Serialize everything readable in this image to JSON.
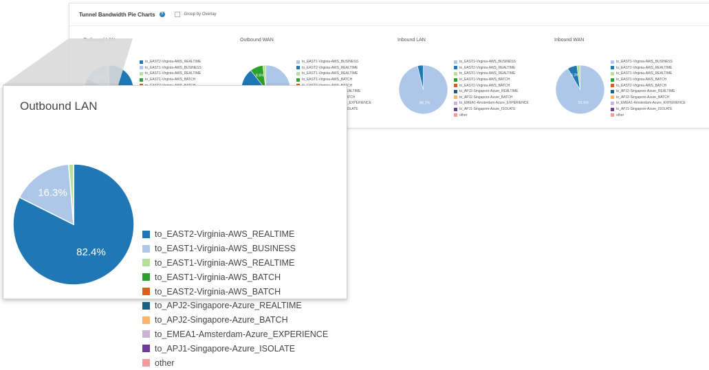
{
  "header": {
    "title": "Tunnel Bandwidth Pie Charts",
    "group_label": "Group by Overlay"
  },
  "chart_data": [
    {
      "type": "pie",
      "title": "Outbound LAN",
      "slices": [
        {
          "label": "to_EAST2-Virginia-AWS_REALTIME",
          "value": 82.4,
          "color": "#1f77b4",
          "show_label": true
        },
        {
          "label": "to_EAST1-Virginia-AWS_BUSINESS",
          "value": 16.3,
          "color": "#aec7e8",
          "show_label": true
        },
        {
          "label": "to_EAST1-Virginia-AWS_REALTIME",
          "value": 1.3,
          "color": "#b5df9a"
        }
      ],
      "legend": [
        {
          "label": "to_EAST2-Virginia-AWS_REALTIME",
          "color": "#1f77b4"
        },
        {
          "label": "to_EAST1-Virginia-AWS_BUSINESS",
          "color": "#aec7e8"
        },
        {
          "label": "to_EAST1-Virginia-AWS_REALTIME",
          "color": "#b5df9a"
        },
        {
          "label": "to_EAST1-Virginia-AWS_BATCH",
          "color": "#2ca02c"
        },
        {
          "label": "to_EAST2-Virginia-AWS_BATCH",
          "color": "#d95f1c"
        },
        {
          "label": "to_APJ2-Singapore-Azure_REALTIME",
          "color": "#1b5e7e"
        },
        {
          "label": "to_APJ2-Singapore-Azure_BATCH",
          "color": "#f7b66a"
        },
        {
          "label": "to_EMEA1-Amsterdam-Azure_EXPERIENCE",
          "color": "#c9b3d6"
        },
        {
          "label": "to_APJ1-Singapore-Azure_ISOLATE",
          "color": "#6a3d9a"
        },
        {
          "label": "other",
          "color": "#f49a9a"
        }
      ]
    },
    {
      "type": "pie",
      "title": "Outbound WAN",
      "slices": [
        {
          "label": "to_EAST1-Virginia-AWS_BUSINESS",
          "value": 75.3,
          "color": "#aec7e8"
        },
        {
          "label": "to_EAST2-Virginia-AWS_REALTIME",
          "value": 14.1,
          "color": "#1f77b4"
        },
        {
          "label": "to_EAST1-Virginia-AWS_BATCH",
          "value": 8.6,
          "color": "#2ca02c",
          "show_label": true
        },
        {
          "label": "to_EAST1-Virginia-AWS_REALTIME",
          "value": 2.0,
          "color": "#b5df9a"
        }
      ],
      "legend": [
        {
          "label": "to_EAST1-Virginia-AWS_BUSINESS",
          "color": "#aec7e8"
        },
        {
          "label": "to_EAST2-Virginia-AWS_REALTIME",
          "color": "#1f77b4"
        },
        {
          "label": "to_EAST1-Virginia-AWS_REALTIME",
          "color": "#b5df9a"
        },
        {
          "label": "to_EAST1-Virginia-AWS_BATCH",
          "color": "#2ca02c"
        },
        {
          "label": "to_EAST2-Virginia-AWS_BATCH",
          "color": "#d95f1c"
        },
        {
          "label": "to_APJ2-Singapore-Azure_REALTIME",
          "color": "#1b5e7e"
        },
        {
          "label": "to_APJ2-Singapore-Azure_BATCH",
          "color": "#f7b66a"
        },
        {
          "label": "to_EMEA1-Amsterdam-Azure_EXPERIENCE",
          "color": "#c9b3d6"
        },
        {
          "label": "to_APJ1-Singapore-Azure_ISOLATE",
          "color": "#6a3d9a"
        },
        {
          "label": "other",
          "color": "#f49a9a"
        }
      ]
    },
    {
      "type": "pie",
      "title": "Inbound LAN",
      "slices": [
        {
          "label": "to_EAST1-Virginia-AWS_BUSINESS",
          "value": 96.2,
          "color": "#aec7e8",
          "show_label": true
        },
        {
          "label": "to_EAST2-Virginia-AWS_REALTIME",
          "value": 3.8,
          "color": "#1f77b4"
        }
      ],
      "legend": [
        {
          "label": "to_EAST1-Virginia-AWS_BUSINESS",
          "color": "#aec7e8"
        },
        {
          "label": "to_EAST2-Virginia-AWS_REALTIME",
          "color": "#1f77b4"
        },
        {
          "label": "to_EAST1-Virginia-AWS_REALTIME",
          "color": "#b5df9a"
        },
        {
          "label": "to_EAST1-Virginia-AWS_BATCH",
          "color": "#2ca02c"
        },
        {
          "label": "to_EAST2-Virginia-AWS_BATCH",
          "color": "#d95f1c"
        },
        {
          "label": "to_APJ2-Singapore-Azure_REALTIME",
          "color": "#1b5e7e"
        },
        {
          "label": "to_APJ2-Singapore-Azure_BATCH",
          "color": "#f7b66a"
        },
        {
          "label": "to_EMEA1-Amsterdam-Azure_EXPERIENCE",
          "color": "#c9b3d6"
        },
        {
          "label": "to_APJ1-Singapore-Azure_ISOLATE",
          "color": "#6a3d9a"
        },
        {
          "label": "other",
          "color": "#f49a9a"
        }
      ]
    },
    {
      "type": "pie",
      "title": "Inbound WAN",
      "slices": [
        {
          "label": "to_EAST1-Virginia-AWS_BUSINESS",
          "value": 91.6,
          "color": "#aec7e8",
          "show_label": true
        },
        {
          "label": "to_EAST2-Virginia-AWS_REALTIME",
          "value": 6.3,
          "color": "#1f77b4",
          "show_label": true
        },
        {
          "label": "to_EAST1-Virginia-AWS_REALTIME",
          "value": 2.1,
          "color": "#b5df9a"
        }
      ],
      "legend": [
        {
          "label": "to_EAST1-Virginia-AWS_BUSINESS",
          "color": "#aec7e8"
        },
        {
          "label": "to_EAST2-Virginia-AWS_REALTIME",
          "color": "#1f77b4"
        },
        {
          "label": "to_EAST1-Virginia-AWS_REALTIME",
          "color": "#b5df9a"
        },
        {
          "label": "to_EAST1-Virginia-AWS_BATCH",
          "color": "#2ca02c"
        },
        {
          "label": "to_EAST2-Virginia-AWS_BATCH",
          "color": "#d95f1c"
        },
        {
          "label": "to_APJ2-Singapore-Azure_REALTIME",
          "color": "#1b5e7e"
        },
        {
          "label": "to_APJ2-Singapore-Azure_BATCH",
          "color": "#f7b66a"
        },
        {
          "label": "to_EMEA1-Amsterdam-Azure_EXPERIENCE",
          "color": "#c9b3d6"
        },
        {
          "label": "to_APJ1-Singapore-Azure_ISOLATE",
          "color": "#6a3d9a"
        },
        {
          "label": "other",
          "color": "#f49a9a"
        }
      ]
    }
  ]
}
